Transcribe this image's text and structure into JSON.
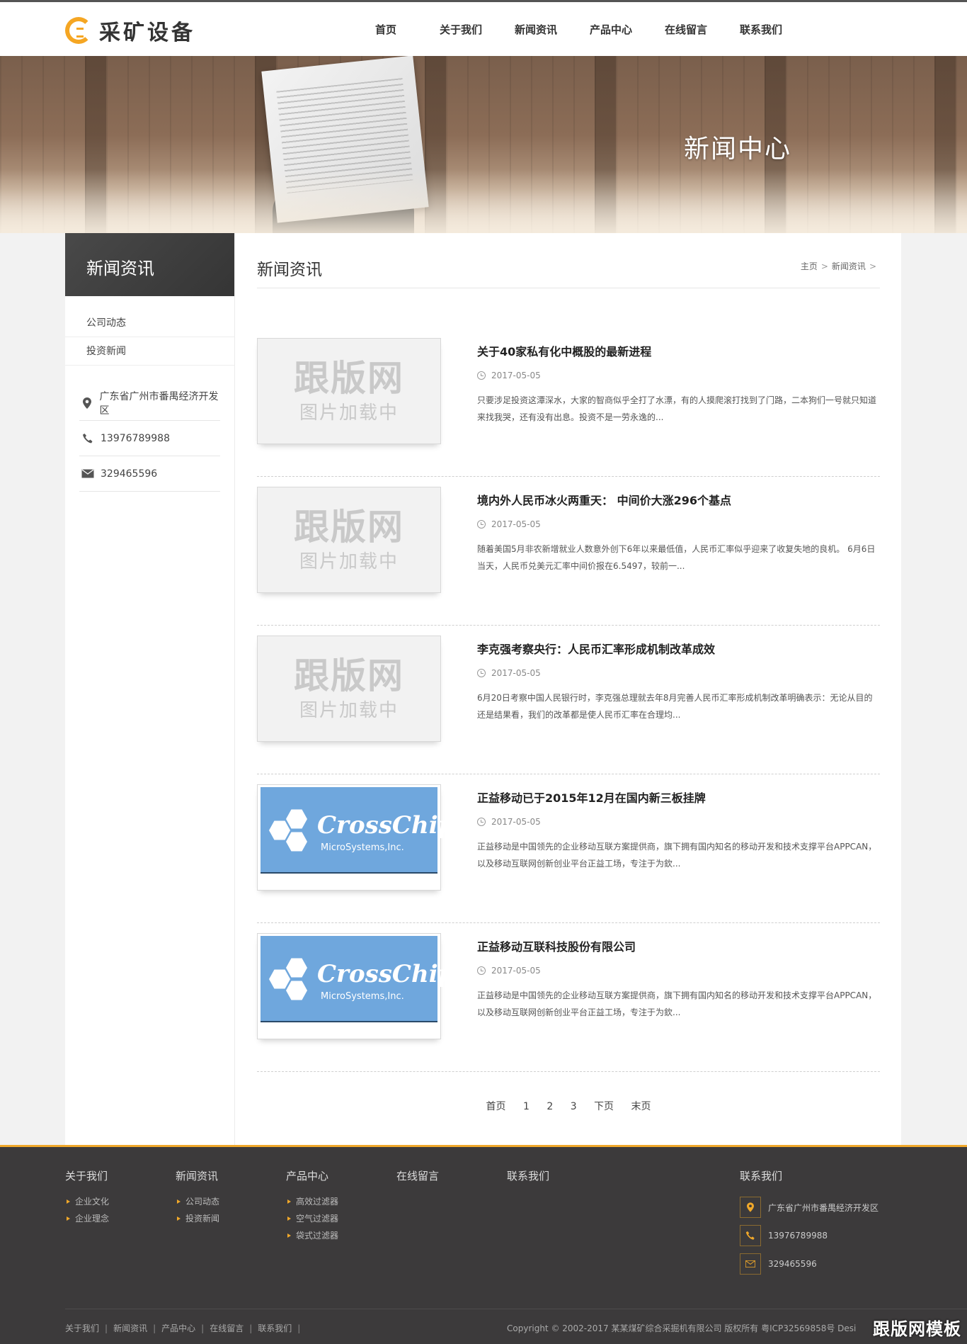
{
  "header": {
    "logo_text": "采矿设备",
    "nav": [
      "首页",
      "关于我们",
      "新闻资讯",
      "产品中心",
      "在线留言",
      "联系我们"
    ]
  },
  "banner": {
    "title": "新闻中心"
  },
  "sidebar": {
    "title": "新闻资讯",
    "menu": [
      "公司动态",
      "投资新闻"
    ],
    "contact": {
      "address": "广东省广州市番禺经济开发区",
      "phone": "13976789988",
      "email": "329465596"
    }
  },
  "main": {
    "title": "新闻资讯",
    "breadcrumb": [
      "主页",
      "新闻资讯"
    ],
    "placeholder": {
      "line1": "跟版网",
      "line2": "图片加载中"
    },
    "logo_thumb": {
      "line1": "CrossChip",
      "line2": "MicroSystems,Inc."
    },
    "items": [
      {
        "title": "关于40家私有化中概股的最新进程",
        "date": "2017-05-05",
        "desc": "只要涉足投资这潭深水，大家的智商似乎全打了水漂，有的人摸爬滚打找到了门路，二本狗们一号就只知道来找我哭，还有没有出息。投资不是一劳永逸的..."
      },
      {
        "title": "境内外人民币冰火两重天： 中间价大涨296个基点",
        "date": "2017-05-05",
        "desc": "随着美国5月非农新增就业人数意外创下6年以来最低值，人民币汇率似乎迎来了收复失地的良机。 6月6日当天，人民币兑美元汇率中间价报在6.5497，较前一..."
      },
      {
        "title": "李克强考察央行：人民币汇率形成机制改革成效",
        "date": "2017-05-05",
        "desc": "6月20日考察中国人民银行时，李克强总理就去年8月完善人民币汇率形成机制改革明确表示：无论从目的还是结果看，我们的改革都是使人民币汇率在合理均..."
      },
      {
        "title": "正益移动已于2015年12月在国内新三板挂牌",
        "date": "2017-05-05",
        "desc": "正益移动是中国领先的企业移动互联方案提供商，旗下拥有国内知名的移动开发和技术支撑平台APPCAN，以及移动互联网创新创业平台正益工场，专注于为欽..."
      },
      {
        "title": "正益移动互联科技股份有限公司",
        "date": "2017-05-05",
        "desc": "正益移动是中国领先的企业移动互联方案提供商，旗下拥有国内知名的移动开发和技术支撑平台APPCAN，以及移动互联网创新创业平台正益工场，专注于为欽..."
      }
    ],
    "pager": [
      "首页",
      "1",
      "2",
      "3",
      "下页",
      "末页"
    ]
  },
  "footer": {
    "cols": [
      {
        "title": "关于我们",
        "links": [
          "企业文化",
          "企业理念"
        ]
      },
      {
        "title": "新闻资讯",
        "links": [
          "公司动态",
          "投资新闻"
        ]
      },
      {
        "title": "产品中心",
        "links": [
          "高效过滤器",
          "空气过滤器",
          "袋式过滤器"
        ]
      },
      {
        "title": "在线留言",
        "links": []
      },
      {
        "title": "联系我们",
        "links": []
      }
    ],
    "contact_title": "联系我们",
    "contact": {
      "address": "广东省广州市番禺经济开发区",
      "phone": "13976789988",
      "email": "329465596"
    },
    "bottom_links": [
      "关于我们",
      "新闻资讯",
      "产品中心",
      "在线留言",
      "联系我们"
    ],
    "copyright": "Copyright © 2002-2017 某某煤矿综合采掘机有限公司 版权所有 粤ICP32569858号 Desi",
    "watermark": "跟版网模板"
  },
  "colors": {
    "accent": "#f0a82a",
    "dark": "#3c3a3b"
  }
}
